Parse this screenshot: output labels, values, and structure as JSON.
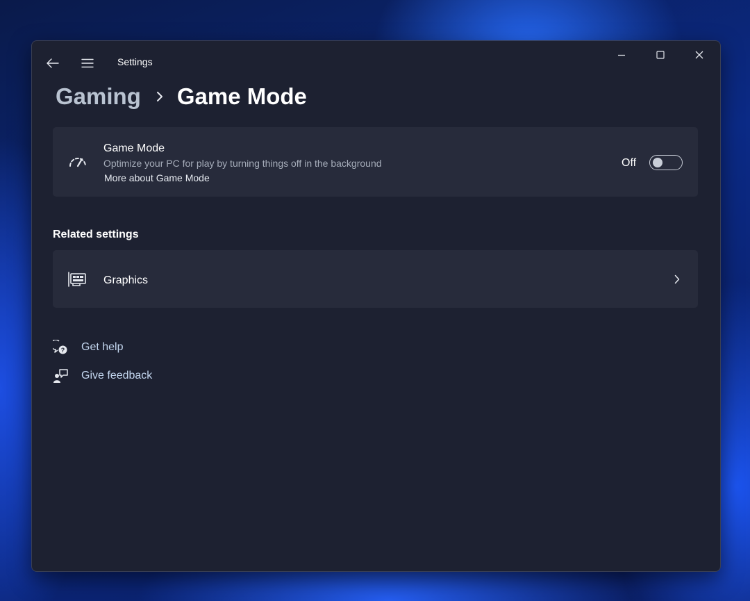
{
  "window": {
    "title": "Settings"
  },
  "breadcrumb": {
    "parent": "Gaming",
    "current": "Game Mode"
  },
  "game_mode": {
    "title": "Game Mode",
    "description": "Optimize your PC for play by turning things off in the background",
    "link": "More about Game Mode",
    "toggle_state": "Off",
    "enabled": false
  },
  "related": {
    "heading": "Related settings",
    "items": [
      {
        "label": "Graphics",
        "icon": "graphics-card-icon"
      }
    ]
  },
  "help": {
    "get_help": "Get help",
    "give_feedback": "Give feedback"
  },
  "colors": {
    "window_bg": "#1d2131",
    "card_bg": "#272b3b",
    "link_color": "#c3d6ef"
  }
}
